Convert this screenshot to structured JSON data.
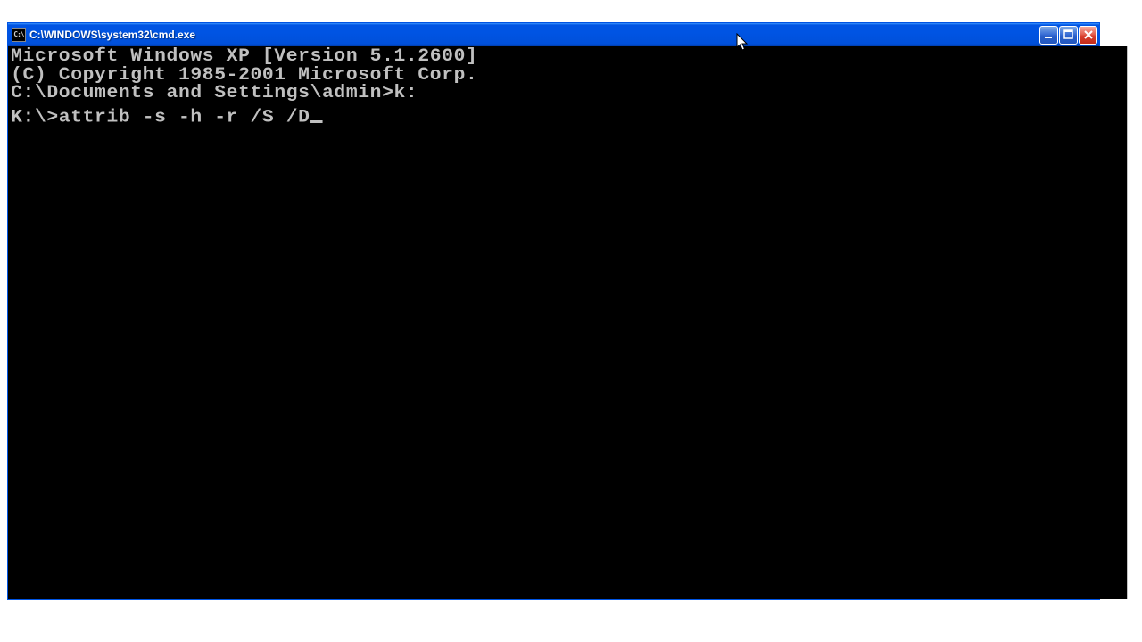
{
  "window": {
    "title": "C:\\WINDOWS\\system32\\cmd.exe",
    "icon_label": "C:\\"
  },
  "terminal": {
    "lines": [
      "Microsoft Windows XP [Version 5.1.2600]",
      "(C) Copyright 1985-2001 Microsoft Corp.",
      "",
      "C:\\Documents and Settings\\admin>k:",
      "",
      "K:\\>attrib -s -h -r /S /D"
    ]
  }
}
